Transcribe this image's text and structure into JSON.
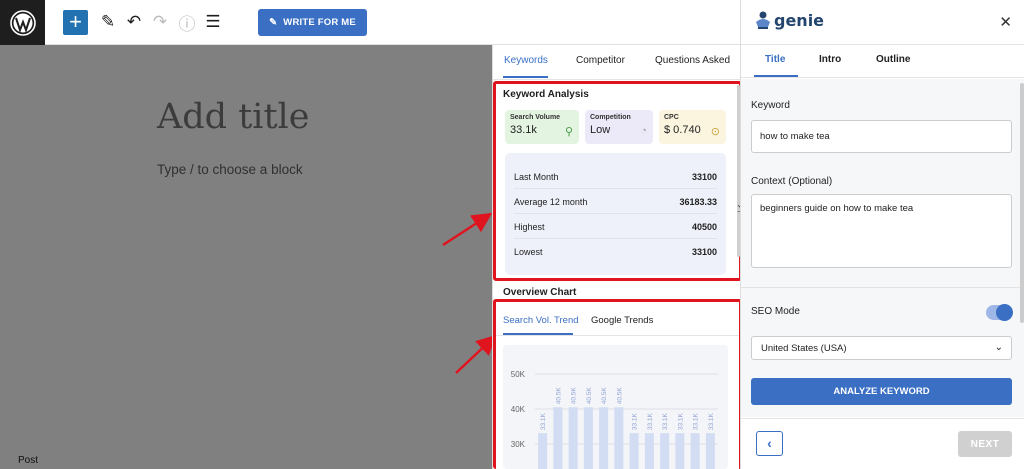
{
  "toolbar": {
    "write_label": "WRITE FOR ME"
  },
  "editor": {
    "title_placeholder": "Add title",
    "block_placeholder": "Type / to choose a block",
    "footer_label": "Post"
  },
  "middle": {
    "tabs": [
      "Keywords",
      "Competitor",
      "Questions Asked"
    ],
    "keyword_analysis": {
      "title": "Keyword Analysis",
      "cards": [
        {
          "label": "Search Volume",
          "value": "33.1k",
          "icon": "search-icon",
          "color": "#e3f4e1"
        },
        {
          "label": "Competition",
          "value": "Low",
          "icon": "gauge-icon",
          "color": "#ece9f8"
        },
        {
          "label": "CPC",
          "value": "$ 0.740",
          "icon": "dollar-icon",
          "color": "#fbf5df"
        }
      ],
      "stats": [
        {
          "label": "Last Month",
          "value": "33100"
        },
        {
          "label": "Average 12 month",
          "value": "36183.33"
        },
        {
          "label": "Highest",
          "value": "40500"
        },
        {
          "label": "Lowest",
          "value": "33100"
        }
      ]
    },
    "overview": {
      "title": "Overview Chart",
      "subtabs": [
        "Search Vol. Trend",
        "Google Trends"
      ]
    }
  },
  "chart_data": {
    "type": "bar",
    "categories": [
      "",
      "",
      "",
      "",
      "",
      "",
      "",
      "",
      "",
      "",
      "",
      ""
    ],
    "values": [
      33100,
      40500,
      40500,
      40500,
      40500,
      40500,
      33100,
      33100,
      33100,
      33100,
      33100,
      33100
    ],
    "data_labels": [
      "33.1K",
      "40.5K",
      "40.5K",
      "40.5K",
      "40.5K",
      "40.5K",
      "33.1K",
      "33.1K",
      "33.1K",
      "33.1K",
      "33.1K",
      "33.1K"
    ],
    "yticks": [
      "50K",
      "40K",
      "30K"
    ],
    "ytick_values": [
      50000,
      40000,
      30000
    ],
    "ylim": [
      25000,
      52000
    ],
    "bar_color": "#d2dcf3",
    "grid": true
  },
  "right": {
    "brand": "genie",
    "tabs": [
      "Title",
      "Intro",
      "Outline"
    ],
    "keyword_label": "Keyword",
    "keyword_value": "how to make tea",
    "context_label": "Context (Optional)",
    "context_value": "beginners guide on how to make tea",
    "seo_label": "SEO Mode",
    "country": "United States (USA)",
    "analyze_label": "ANALYZE KEYWORD",
    "next_label": "NEXT"
  },
  "colors": {
    "accent": "#3a6fc4",
    "highlight": "#e0141e"
  }
}
